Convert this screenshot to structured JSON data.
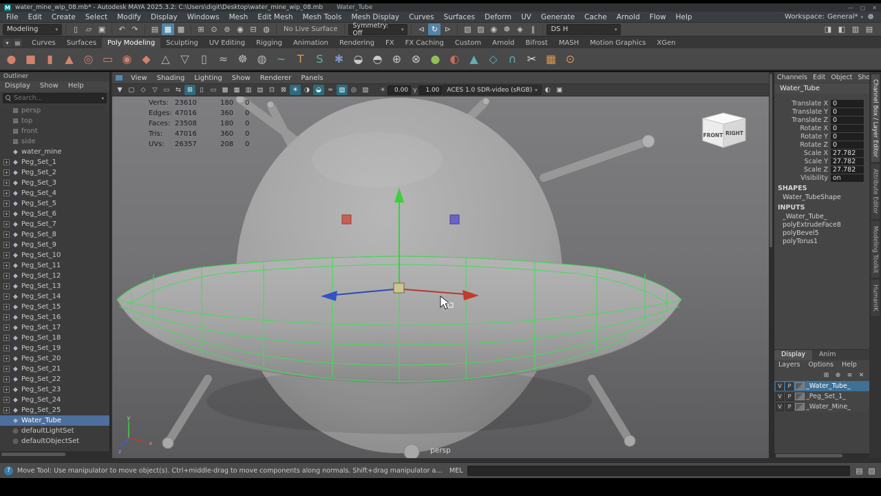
{
  "colors": {
    "accent_blue": "#5285a6",
    "selection_blue": "#4d6f9d",
    "layer_selection_blue": "#3f7096",
    "wireframe_selected_green": "#3fdf55",
    "axis_x_red": "#c33a2e",
    "axis_y_green": "#3ecf3e",
    "axis_z_blue": "#3048c0",
    "manipulator_center_tan": "#cdc492",
    "viewport_gray_top": "#7e7e80",
    "viewport_gray_bottom": "#5a5a5c"
  },
  "title_bar": {
    "app_icon": "M",
    "title": "water_mine_wip_08.mb* - Autodesk MAYA 2025.3.2: C:\\Users\\digit\\Desktop\\water_mine_wip_08.mb",
    "object": "Water_Tube",
    "minimize": "—",
    "maximize": "▢",
    "close": "✕"
  },
  "menu_bar": {
    "items": [
      "File",
      "Edit",
      "Create",
      "Select",
      "Modify",
      "Display",
      "Windows",
      "Mesh",
      "Edit Mesh",
      "Mesh Tools",
      "Mesh Display",
      "Curves",
      "Surfaces",
      "Deform",
      "UV",
      "Generate",
      "Cache",
      "Arnold",
      "Flow",
      "Help"
    ],
    "workspace_label": "Workspace:",
    "workspace_value": "General*",
    "settings_icon": "☸"
  },
  "status_line": {
    "menu_set": "Modeling",
    "file_icons": [
      {
        "name": "new-scene-icon",
        "glyph": "▯"
      },
      {
        "name": "open-scene-icon",
        "glyph": "▱"
      },
      {
        "name": "save-scene-icon",
        "glyph": "▣"
      }
    ],
    "edit_icons": [
      {
        "name": "undo-icon",
        "glyph": "↶"
      },
      {
        "name": "redo-icon",
        "glyph": "↷"
      }
    ],
    "select_icons": [
      {
        "name": "select-by-hierarchy-icon",
        "glyph": "▤"
      },
      {
        "name": "select-by-object-icon",
        "glyph": "▦",
        "active": true
      },
      {
        "name": "select-by-component-icon",
        "glyph": "▩"
      }
    ],
    "snap_icons": [
      {
        "name": "snap-to-grid-icon",
        "glyph": "⊞"
      },
      {
        "name": "snap-to-curve-icon",
        "glyph": "⊙"
      },
      {
        "name": "snap-to-point-icon",
        "glyph": "⊚"
      },
      {
        "name": "snap-to-projected-center-icon",
        "glyph": "◉"
      },
      {
        "name": "snap-to-view-plane-icon",
        "glyph": "⊟"
      },
      {
        "name": "make-live-icon",
        "glyph": "◍"
      }
    ],
    "live_surface_label": "No Live Surface",
    "symmetry_label": "Symmetry: Off",
    "history_icons": [
      {
        "name": "input-to-selected-icon",
        "glyph": "⊲"
      },
      {
        "name": "construction-history-icon",
        "glyph": "↻",
        "active": true
      },
      {
        "name": "output-from-selected-icon",
        "glyph": "⊳"
      }
    ],
    "render_icons": [
      {
        "name": "open-render-view-icon",
        "glyph": "▧"
      },
      {
        "name": "render-current-frame-icon",
        "glyph": "▨"
      },
      {
        "name": "ipr-render-icon",
        "glyph": "◉"
      },
      {
        "name": "render-settings-icon",
        "glyph": "☸"
      },
      {
        "name": "launch-hypershade-icon",
        "glyph": "◈"
      },
      {
        "name": "pause-viewport-icon",
        "glyph": "‖"
      }
    ],
    "ds_value": "DS H",
    "sidebar_icons": [
      {
        "name": "toggle-attribute-editor-icon",
        "glyph": "◨"
      },
      {
        "name": "toggle-tool-settings-icon",
        "glyph": "◧"
      },
      {
        "name": "toggle-channel-box-icon",
        "glyph": "▥"
      },
      {
        "name": "toggle-outliner-icon",
        "glyph": "▤"
      }
    ]
  },
  "shelf": {
    "tabs": [
      {
        "label": "Curves"
      },
      {
        "label": "Surfaces"
      },
      {
        "label": "Poly Modeling",
        "active": true
      },
      {
        "label": "Sculpting"
      },
      {
        "label": "UV Editing"
      },
      {
        "label": "Rigging"
      },
      {
        "label": "Animation"
      },
      {
        "label": "Rendering"
      },
      {
        "label": "FX"
      },
      {
        "label": "FX Caching"
      },
      {
        "label": "Custom"
      },
      {
        "label": "Arnold"
      },
      {
        "label": "Bifrost"
      },
      {
        "label": "MASH"
      },
      {
        "label": "Motion Graphics"
      },
      {
        "label": "XGen"
      }
    ],
    "icons": [
      {
        "name": "shelf-poly-sphere-icon",
        "glyph": "●",
        "color": "#d2826d"
      },
      {
        "name": "shelf-poly-cube-icon",
        "glyph": "■",
        "color": "#d2826d"
      },
      {
        "name": "shelf-poly-cylinder-icon",
        "glyph": "▮",
        "color": "#d2826d"
      },
      {
        "name": "shelf-poly-cone-icon",
        "glyph": "▲",
        "color": "#d2826d"
      },
      {
        "name": "shelf-poly-torus-icon",
        "glyph": "◎",
        "color": "#d2826d"
      },
      {
        "name": "shelf-poly-plane-icon",
        "glyph": "▭",
        "color": "#d2826d"
      },
      {
        "name": "shelf-poly-disc-icon",
        "glyph": "◉",
        "color": "#d2826d"
      },
      {
        "name": "shelf-platonic-solid-icon",
        "glyph": "◆",
        "color": "#d2826d"
      },
      {
        "name": "shelf-poly-pyramid-icon",
        "glyph": "△",
        "color": "#b9b9b9"
      },
      {
        "name": "shelf-poly-prism-icon",
        "glyph": "▽",
        "color": "#b9b9b9"
      },
      {
        "name": "shelf-poly-pipe-icon",
        "glyph": "▯",
        "color": "#b9b9b9"
      },
      {
        "name": "shelf-poly-helix-icon",
        "glyph": "≈",
        "color": "#b9b9b9"
      },
      {
        "name": "shelf-poly-gear-icon",
        "glyph": "☸",
        "color": "#b9b9b9"
      },
      {
        "name": "shelf-poly-soccer-ball-icon",
        "glyph": "◍",
        "color": "#b9b9b9"
      },
      {
        "name": "shelf-sweep-mesh-icon",
        "glyph": "~",
        "color": "#62b0b0"
      },
      {
        "name": "shelf-poly-type-icon",
        "glyph": "T",
        "color": "#dc9a50"
      },
      {
        "name": "shelf-svg-icon",
        "glyph": "S",
        "color": "#62b0b0"
      },
      {
        "name": "shelf-ultra-shape-icon",
        "glyph": "✱",
        "color": "#7a95c4"
      },
      {
        "name": "shelf-boolean-union-icon",
        "glyph": "◒",
        "color": "#c9c9c9"
      },
      {
        "name": "shelf-boolean-difference-icon",
        "glyph": "◓",
        "color": "#c9c9c9"
      },
      {
        "name": "shelf-combine-icon",
        "glyph": "⊕",
        "color": "#c9c9c9"
      },
      {
        "name": "shelf-separate-icon",
        "glyph": "⊗",
        "color": "#c9c9c9"
      },
      {
        "name": "shelf-smooth-icon",
        "glyph": "●",
        "color": "#8fc05a"
      },
      {
        "name": "shelf-mirror-icon",
        "glyph": "◐",
        "color": "#cd6a5a"
      },
      {
        "name": "shelf-extrude-icon",
        "glyph": "▲",
        "color": "#62b0b0"
      },
      {
        "name": "shelf-bevel-icon",
        "glyph": "◇",
        "color": "#62b0b0"
      },
      {
        "name": "shelf-bridge-icon",
        "glyph": "∩",
        "color": "#62b0b0"
      },
      {
        "name": "shelf-multi-cut-icon",
        "glyph": "✂",
        "color": "#e0e0e0"
      },
      {
        "name": "shelf-quad-draw-icon",
        "glyph": "▦",
        "color": "#dc9a50"
      },
      {
        "name": "shelf-target-weld-icon",
        "glyph": "⊙",
        "color": "#dc9a50"
      }
    ]
  },
  "outliner": {
    "panel_title": "Outliner",
    "menus": [
      "Display",
      "Show",
      "Help"
    ],
    "search_placeholder": "Search...",
    "items": [
      {
        "label": "persp",
        "type": "camera",
        "icon": "▦",
        "dim": true
      },
      {
        "label": "top",
        "type": "camera",
        "icon": "▦",
        "dim": true
      },
      {
        "label": "front",
        "type": "camera",
        "icon": "▦",
        "dim": true
      },
      {
        "label": "side",
        "type": "camera",
        "icon": "▦",
        "dim": true
      },
      {
        "label": "water_mine",
        "type": "mesh",
        "icon": "◆"
      },
      {
        "label": "Peg_Set_1",
        "type": "group",
        "icon": "◆",
        "expander": "+"
      },
      {
        "label": "Peg_Set_2",
        "type": "group",
        "icon": "◆",
        "expander": "+"
      },
      {
        "label": "Peg_Set_3",
        "type": "group",
        "icon": "◆",
        "expander": "+"
      },
      {
        "label": "Peg_Set_4",
        "type": "group",
        "icon": "◆",
        "expander": "+"
      },
      {
        "label": "Peg_Set_5",
        "type": "group",
        "icon": "◆",
        "expander": "+"
      },
      {
        "label": "Peg_Set_6",
        "type": "group",
        "icon": "◆",
        "expander": "+"
      },
      {
        "label": "Peg_Set_7",
        "type": "group",
        "icon": "◆",
        "expander": "+"
      },
      {
        "label": "Peg_Set_8",
        "type": "group",
        "icon": "◆",
        "expander": "+"
      },
      {
        "label": "Peg_Set_9",
        "type": "group",
        "icon": "◆",
        "expander": "+"
      },
      {
        "label": "Peg_Set_10",
        "type": "group",
        "icon": "◆",
        "expander": "+"
      },
      {
        "label": "Peg_Set_11",
        "type": "group",
        "icon": "◆",
        "expander": "+"
      },
      {
        "label": "Peg_Set_12",
        "type": "group",
        "icon": "◆",
        "expander": "+"
      },
      {
        "label": "Peg_Set_13",
        "type": "group",
        "icon": "◆",
        "expander": "+"
      },
      {
        "label": "Peg_Set_14",
        "type": "group",
        "icon": "◆",
        "expander": "+"
      },
      {
        "label": "Peg_Set_15",
        "type": "group",
        "icon": "◆",
        "expander": "+"
      },
      {
        "label": "Peg_Set_16",
        "type": "group",
        "icon": "◆",
        "expander": "+"
      },
      {
        "label": "Peg_Set_17",
        "type": "group",
        "icon": "◆",
        "expander": "+"
      },
      {
        "label": "Peg_Set_18",
        "type": "group",
        "icon": "◆",
        "expander": "+"
      },
      {
        "label": "Peg_Set_19",
        "type": "group",
        "icon": "◆",
        "expander": "+"
      },
      {
        "label": "Peg_Set_20",
        "type": "group",
        "icon": "◆",
        "expander": "+"
      },
      {
        "label": "Peg_Set_21",
        "type": "group",
        "icon": "◆",
        "expander": "+"
      },
      {
        "label": "Peg_Set_22",
        "type": "group",
        "icon": "◆",
        "expander": "+"
      },
      {
        "label": "Peg_Set_23",
        "type": "group",
        "icon": "◆",
        "expander": "+"
      },
      {
        "label": "Peg_Set_24",
        "type": "group",
        "icon": "◆",
        "expander": "+"
      },
      {
        "label": "Peg_Set_25",
        "type": "group",
        "icon": "◆",
        "expander": "+"
      },
      {
        "label": "Water_Tube",
        "type": "mesh",
        "icon": "◆",
        "selected": true
      },
      {
        "label": "defaultLightSet",
        "type": "set",
        "icon": "◎"
      },
      {
        "label": "defaultObjectSet",
        "type": "set",
        "icon": "◎"
      }
    ]
  },
  "viewport": {
    "menus": [
      "View",
      "Shading",
      "Lighting",
      "Show",
      "Renderer",
      "Panels"
    ],
    "toolbar_icons": [
      {
        "name": "viewport-select-camera-icon",
        "glyph": "▼"
      },
      {
        "name": "viewport-lock-camera-icon",
        "glyph": "▢"
      },
      {
        "name": "viewport-camera-attributes-icon",
        "glyph": "◇"
      },
      {
        "name": "viewport-bookmarks-icon",
        "glyph": "▽"
      },
      {
        "name": "viewport-image-plane-icon",
        "glyph": "▭"
      },
      {
        "name": "viewport-2d-pan-zoom-icon",
        "glyph": "⇆"
      },
      {
        "name": "viewport-grid-icon",
        "glyph": "⊞",
        "active": true
      },
      {
        "name": "viewport-film-gate-icon",
        "glyph": "▯"
      },
      {
        "name": "viewport-resolution-gate-icon",
        "glyph": "▭"
      },
      {
        "name": "viewport-gate-mask-icon",
        "glyph": "▩"
      },
      {
        "name": "viewport-field-chart-icon",
        "glyph": "▦"
      },
      {
        "name": "viewport-safe-action-icon",
        "glyph": "▥"
      },
      {
        "name": "viewport-safe-title-icon",
        "glyph": "▤"
      },
      {
        "name": "viewport-frame-all-icon",
        "glyph": "⊡"
      },
      {
        "name": "viewport-frame-selection-icon",
        "glyph": "⊠"
      },
      {
        "name": "viewport-lighting-icon",
        "glyph": "☀",
        "active": true
      },
      {
        "name": "viewport-shadows-icon",
        "glyph": "◑"
      },
      {
        "name": "viewport-ambient-occlusion-icon",
        "glyph": "◒",
        "active": true
      },
      {
        "name": "viewport-motion-blur-icon",
        "glyph": "≈"
      },
      {
        "name": "viewport-multisample-aa-icon",
        "glyph": "▧",
        "active": true
      },
      {
        "name": "viewport-isolate-select-icon",
        "glyph": "◎"
      },
      {
        "name": "viewport-xray-icon",
        "glyph": "▨"
      }
    ],
    "exposure_value": "0.00",
    "gamma_value": "1.00",
    "colorspace": "ACES 1.0 SDR-video (sRGB)",
    "toolbar_right_icons": [
      {
        "name": "viewport-color-management-icon",
        "glyph": "◐"
      },
      {
        "name": "viewport-snapshot-icon",
        "glyph": "▣"
      }
    ],
    "hud_rows": [
      {
        "label": "Verts:",
        "total": "23610",
        "selected": "180",
        "third": "0"
      },
      {
        "label": "Edges:",
        "total": "47016",
        "selected": "360",
        "third": "0"
      },
      {
        "label": "Faces:",
        "total": "23508",
        "selected": "180",
        "third": "0"
      },
      {
        "label": "Tris:",
        "total": "47016",
        "selected": "360",
        "third": "0"
      },
      {
        "label": "UVs:",
        "total": "26357",
        "selected": "208",
        "third": "0"
      }
    ],
    "camera_label": "persp",
    "viewcube": {
      "front": "FRONT",
      "right": "RIGHT"
    },
    "axis": {
      "x": "x",
      "y": "y",
      "z": "z"
    }
  },
  "channel_box": {
    "menus": [
      "Channels",
      "Edit",
      "Object",
      "Show"
    ],
    "object_name": "Water_Tube",
    "attributes": [
      {
        "label": "Translate X",
        "value": "0"
      },
      {
        "label": "Translate Y",
        "value": "0"
      },
      {
        "label": "Translate Z",
        "value": "0"
      },
      {
        "label": "Rotate X",
        "value": "0"
      },
      {
        "label": "Rotate Y",
        "value": "0"
      },
      {
        "label": "Rotate Z",
        "value": "0"
      },
      {
        "label": "Scale X",
        "value": "27.782"
      },
      {
        "label": "Scale Y",
        "value": "27.782"
      },
      {
        "label": "Scale Z",
        "value": "27.782"
      },
      {
        "label": "Visibility",
        "value": "on"
      }
    ],
    "shapes_header": "SHAPES",
    "shapes": [
      "Water_TubeShape"
    ],
    "inputs_header": "INPUTS",
    "inputs": [
      "_Water_Tube_",
      "polyExtrudeFace8",
      "polyBevel5",
      "polyTorus1"
    ]
  },
  "layer_editor": {
    "tabs": [
      {
        "label": "Display",
        "active": true
      },
      {
        "label": "Anim"
      }
    ],
    "menus": [
      "Layers",
      "Options",
      "Help"
    ],
    "toolbar_icons": [
      {
        "name": "new-empty-layer-icon",
        "glyph": "⊞"
      },
      {
        "name": "new-layer-from-selected-icon",
        "glyph": "⊕"
      },
      {
        "name": "layer-attributes-icon",
        "glyph": "≡"
      },
      {
        "name": "delete-layer-icon",
        "glyph": "✕"
      }
    ],
    "layers": [
      {
        "v": "V",
        "p": "P",
        "label": "_Water_Tube_",
        "selected": true
      },
      {
        "v": "V",
        "p": "P",
        "label": "_Peg_Set_1_"
      },
      {
        "v": "V",
        "p": "P",
        "label": "_Water_Mine_"
      }
    ]
  },
  "side_tabs": [
    {
      "label": "Channel Box / Layer Editor",
      "active": true
    },
    {
      "label": "Attribute Editor"
    },
    {
      "label": "Modeling Toolkit"
    },
    {
      "label": "HumanIK"
    }
  ],
  "help_line": {
    "help_text": "Move Tool: Use manipulator to move object(s). Ctrl+middle-drag to move components along normals. Shift+drag manipulator axis or plane handles to extrude components or clone object",
    "mel_label": "MEL",
    "command_value": ""
  }
}
